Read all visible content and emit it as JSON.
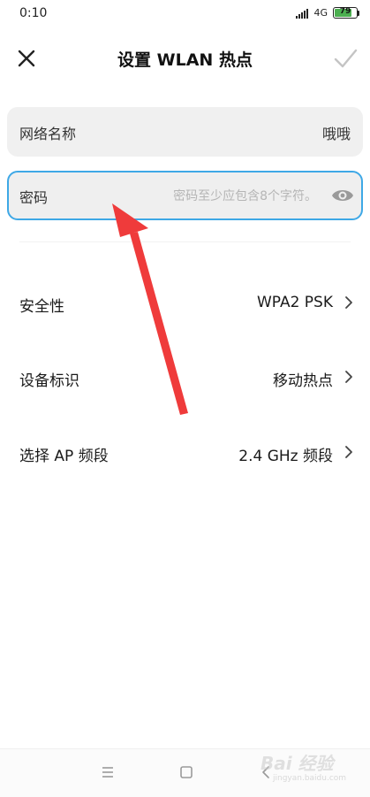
{
  "status_bar": {
    "time": "0:10",
    "network": "4G",
    "battery_level": "79",
    "battery_fill_percent": 79,
    "battery_color": "#4caf50"
  },
  "header": {
    "title": "设置 WLAN 热点",
    "close_icon": "close-icon",
    "confirm_icon": "check-icon"
  },
  "form": {
    "ssid": {
      "label": "网络名称",
      "value": "哦哦"
    },
    "password": {
      "label": "密码",
      "value": "",
      "placeholder": "密码至少应包含8个字符。",
      "visibility_icon": "eye-icon"
    }
  },
  "settings": [
    {
      "label": "安全性",
      "value": "WPA2 PSK"
    },
    {
      "label": "设备标识",
      "value": "移动热点"
    },
    {
      "label": "选择 AP 频段",
      "value": "2.4 GHz 频段"
    }
  ],
  "colors": {
    "focus_border": "#3ea8e6",
    "field_background": "#f0f0f0",
    "annotation_arrow": "#ef3b3b",
    "confirm_disabled": "#c4c4c4"
  },
  "watermark": {
    "main": "Bai 经验",
    "sub": "jingyan.baidu.com"
  }
}
